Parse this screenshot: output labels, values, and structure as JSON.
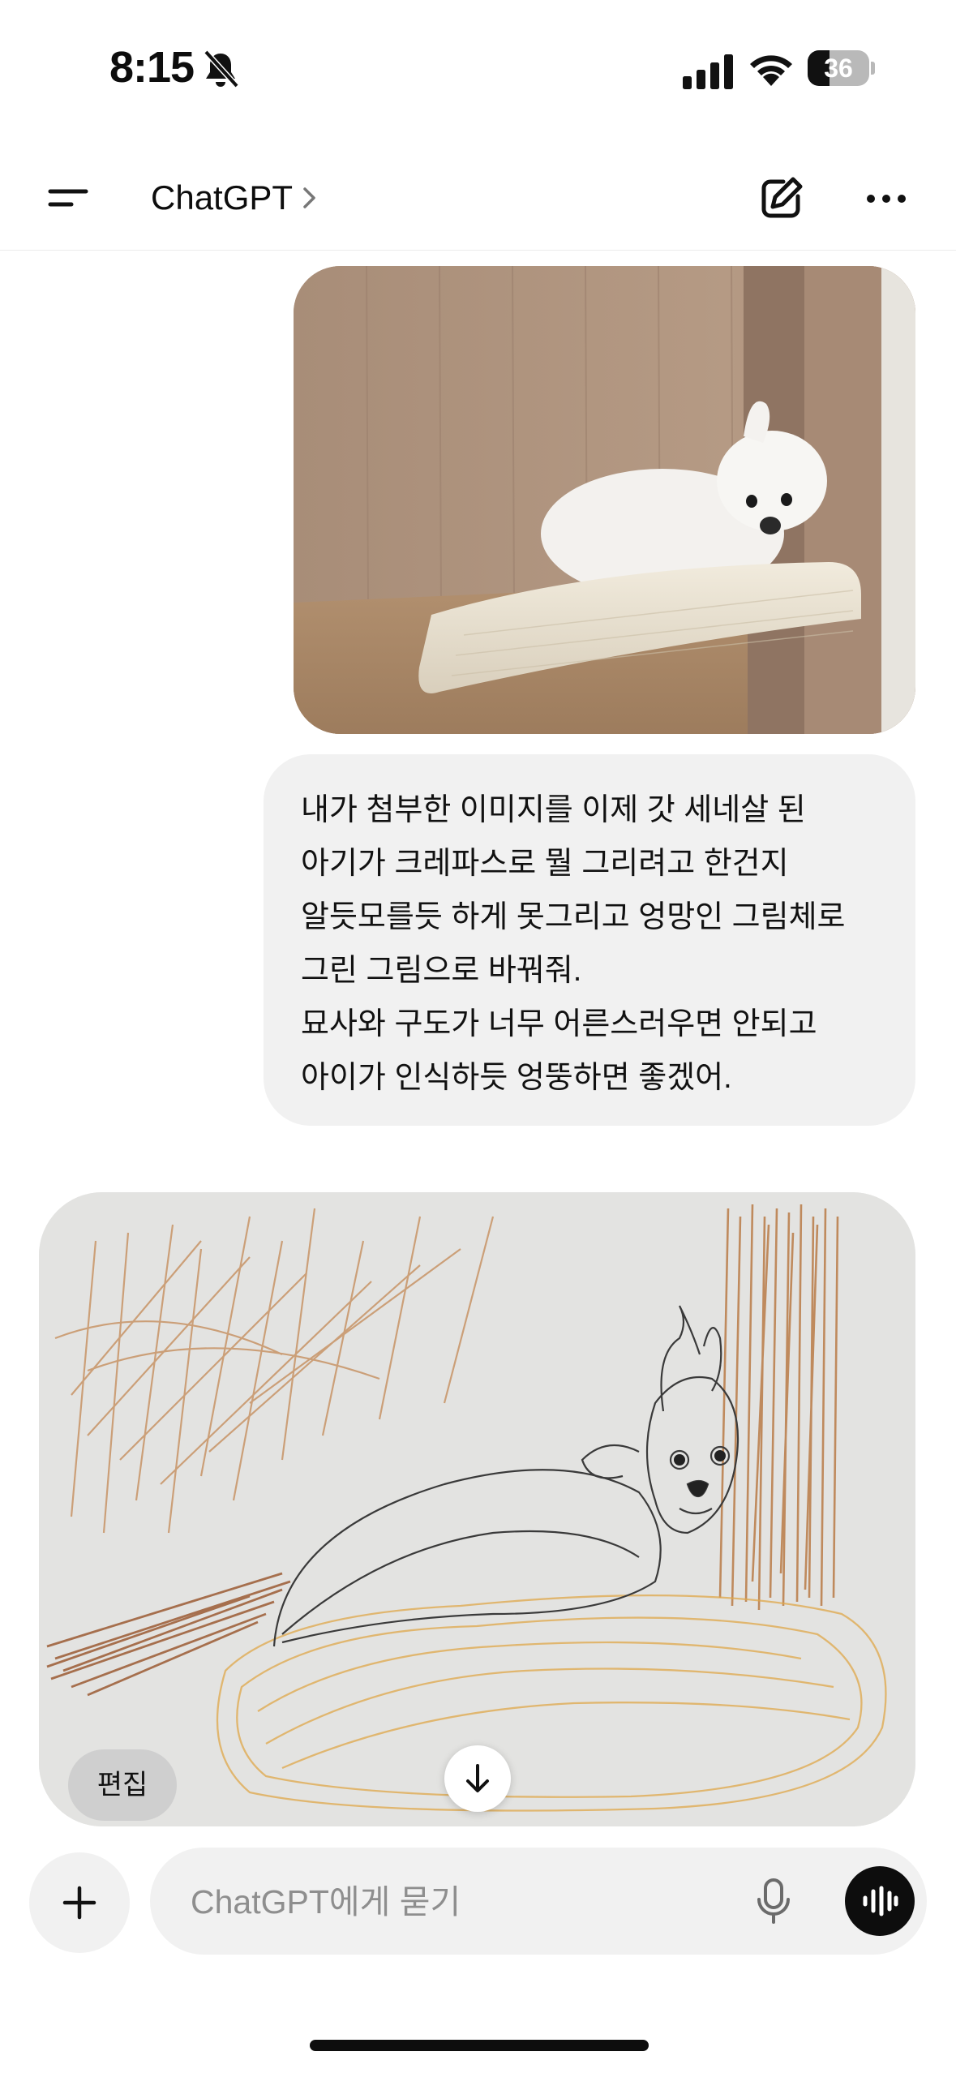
{
  "status_bar": {
    "time": "8:15",
    "battery_level": "36",
    "battery_fraction": 0.36
  },
  "header": {
    "title": "ChatGPT"
  },
  "messages": {
    "user_text": "내가 첨부한 이미지를 이제 갓 세네살 된\n아기가 크레파스로 뭘 그리려고 한건지\n알듯모를듯 하게 못그리고 엉망인 그림체로\n그린 그림으로 바꿔줘.\n묘사와 구도가 너무 어른스러우면 안되고\n아이가 인식하듯 엉뚱하면 좋겠어.",
    "edit_label": "편집"
  },
  "composer": {
    "placeholder": "ChatGPT에게 묻기"
  },
  "icons": {
    "bell": "bell-slash-icon",
    "signal": "cellular-signal-icon",
    "wifi": "wifi-icon",
    "menu": "menu-icon",
    "chevron": "chevron-right-icon",
    "compose": "new-chat-icon",
    "more": "more-icon",
    "scroll": "arrow-down-icon",
    "plus": "plus-icon",
    "mic": "microphone-icon",
    "voice": "voice-mode-icon"
  }
}
